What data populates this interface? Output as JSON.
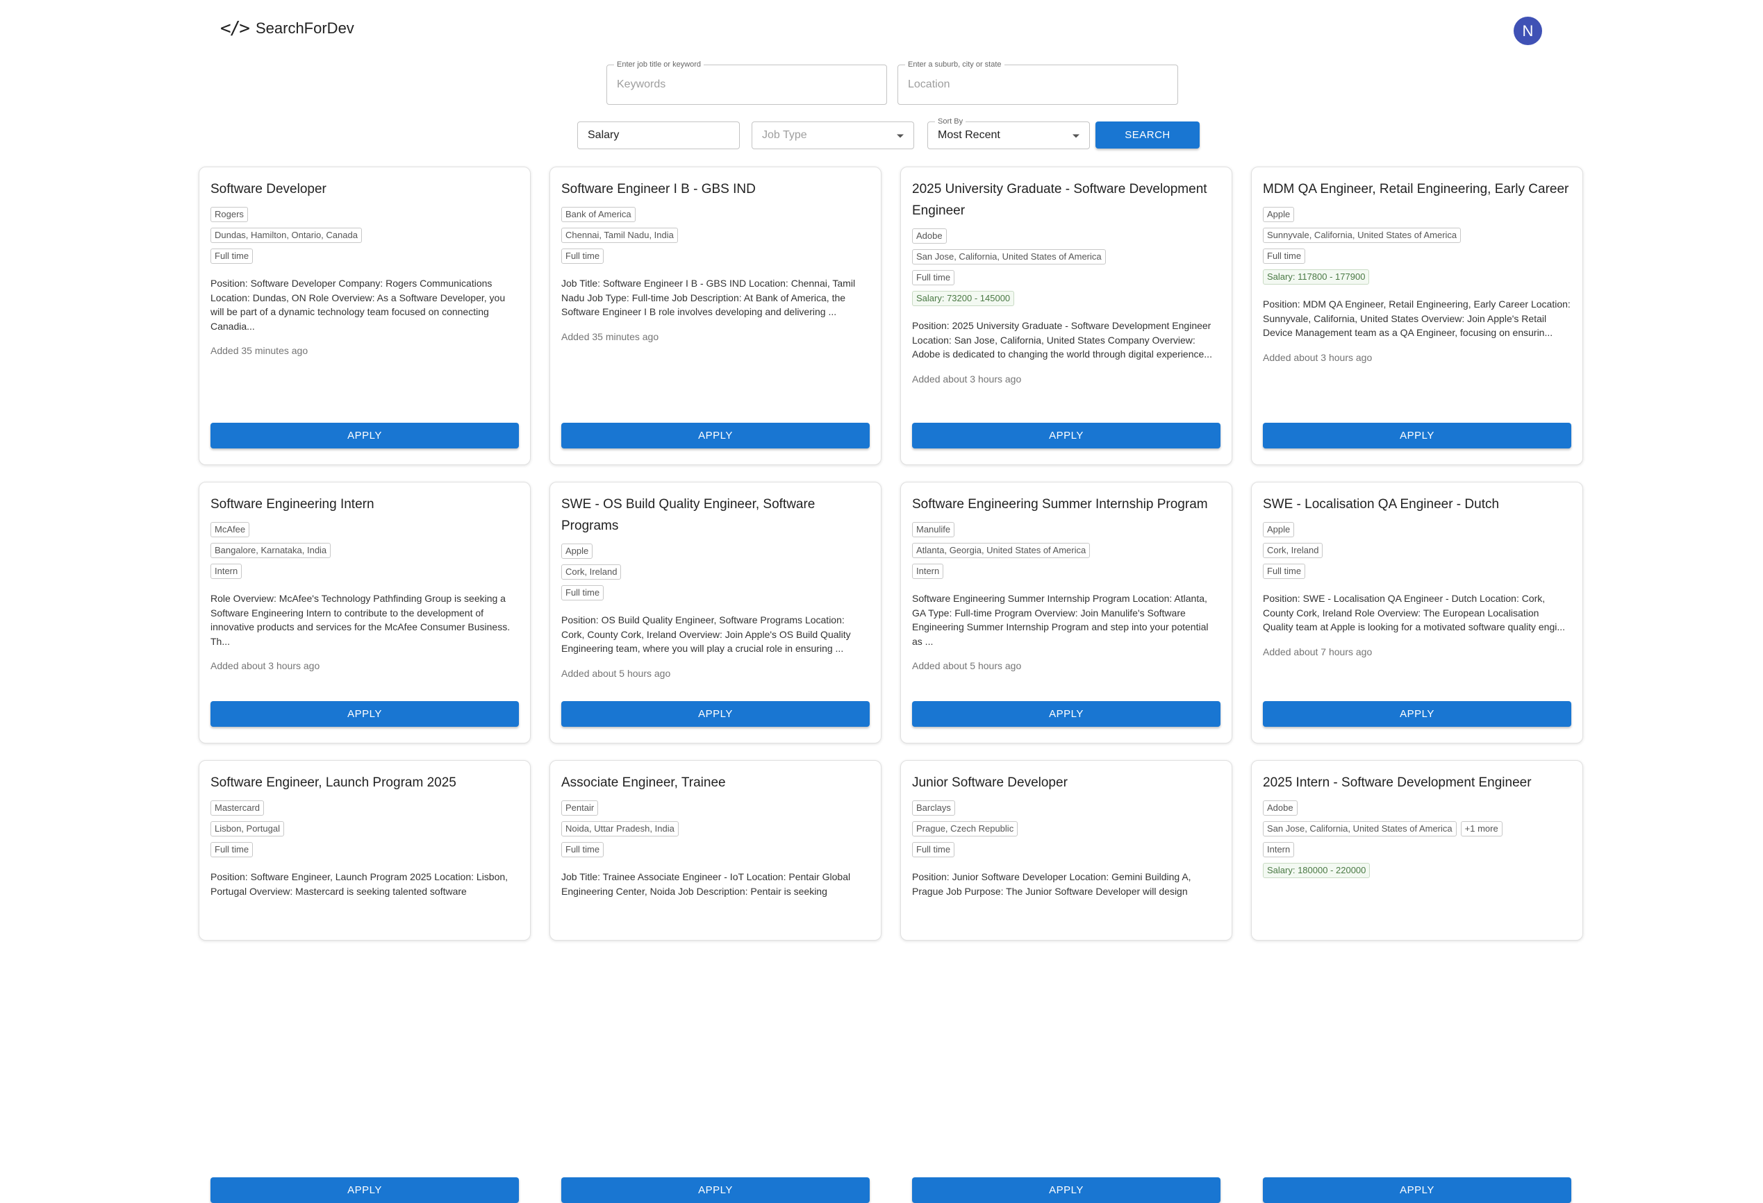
{
  "app": {
    "logo_icon": "</>",
    "logo_text": "SearchForDev",
    "avatar_initial": "N"
  },
  "search": {
    "keywords_legend": "Enter job title or keyword",
    "keywords_placeholder": "Keywords",
    "location_legend": "Enter a suburb, city or state",
    "location_placeholder": "Location",
    "salary_value": "Salary",
    "job_type_placeholder": "Job Type",
    "sort_legend": "Sort By",
    "sort_value": "Most Recent",
    "search_label": "SEARCH"
  },
  "apply_label": "APPLY",
  "jobs": [
    {
      "title": "Software Developer",
      "company": "Rogers",
      "location": "Dundas, Hamilton, Ontario, Canada",
      "type": "Full time",
      "salary": "",
      "more": "",
      "description": "Position: Software Developer Company: Rogers Communications Location: Dundas, ON Role Overview: As a Software Developer, you will be part of a dynamic technology team focused on connecting Canadia...",
      "added": "Added 35 minutes ago"
    },
    {
      "title": "Software Engineer I B - GBS IND",
      "company": "Bank of America",
      "location": "Chennai, Tamil Nadu, India",
      "type": "Full time",
      "salary": "",
      "more": "",
      "description": "Job Title: Software Engineer I B - GBS IND Location: Chennai, Tamil Nadu Job Type: Full-time Job Description: At Bank of America, the Software Engineer I B role involves developing and delivering ...",
      "added": "Added 35 minutes ago"
    },
    {
      "title": "2025 University Graduate - Software Development Engineer",
      "company": "Adobe",
      "location": "San Jose, California, United States of America",
      "type": "Full time",
      "salary": "Salary: 73200 - 145000",
      "more": "",
      "description": "Position: 2025 University Graduate - Software Development Engineer Location: San Jose, California, United States Company Overview: Adobe is dedicated to changing the world through digital experience...",
      "added": "Added about 3 hours ago"
    },
    {
      "title": "MDM QA Engineer, Retail Engineering, Early Career",
      "company": "Apple",
      "location": "Sunnyvale, California, United States of America",
      "type": "Full time",
      "salary": "Salary: 117800 - 177900",
      "more": "",
      "description": "Position: MDM QA Engineer, Retail Engineering, Early Career Location: Sunnyvale, California, United States Overview: Join Apple's Retail Device Management team as a QA Engineer, focusing on ensurin...",
      "added": "Added about 3 hours ago"
    },
    {
      "title": "Software Engineering Intern",
      "company": "McAfee",
      "location": "Bangalore, Karnataka, India",
      "type": "Intern",
      "salary": "",
      "more": "",
      "description": "Role Overview: McAfee's Technology Pathfinding Group is seeking a Software Engineering Intern to contribute to the development of innovative products and services for the McAfee Consumer Business. Th...",
      "added": "Added about 3 hours ago"
    },
    {
      "title": "SWE - OS Build Quality Engineer, Software Programs",
      "company": "Apple",
      "location": "Cork, Ireland",
      "type": "Full time",
      "salary": "",
      "more": "",
      "description": "Position: OS Build Quality Engineer, Software Programs Location: Cork, County Cork, Ireland Overview: Join Apple's OS Build Quality Engineering team, where you will play a crucial role in ensuring ...",
      "added": "Added about 5 hours ago"
    },
    {
      "title": "Software Engineering Summer Internship Program",
      "company": "Manulife",
      "location": "Atlanta, Georgia, United States of America",
      "type": "Intern",
      "salary": "",
      "more": "",
      "description": "Software Engineering Summer Internship Program Location: Atlanta, GA Type: Full-time Program Overview: Join Manulife's Software Engineering Summer Internship Program and step into your potential as ...",
      "added": "Added about 5 hours ago"
    },
    {
      "title": "SWE - Localisation QA Engineer - Dutch",
      "company": "Apple",
      "location": "Cork, Ireland",
      "type": "Full time",
      "salary": "",
      "more": "",
      "description": "Position: SWE - Localisation QA Engineer - Dutch Location: Cork, County Cork, Ireland Role Overview: The European Localisation Quality team at Apple is looking for a motivated software quality engi...",
      "added": "Added about 7 hours ago"
    },
    {
      "title": "Software Engineer, Launch Program 2025",
      "company": "Mastercard",
      "location": "Lisbon, Portugal",
      "type": "Full time",
      "salary": "",
      "more": "",
      "description": "Position: Software Engineer, Launch Program 2025 Location: Lisbon, Portugal Overview: Mastercard is seeking talented software",
      "added": ""
    },
    {
      "title": "Associate Engineer, Trainee",
      "company": "Pentair",
      "location": "Noida, Uttar Pradesh, India",
      "type": "Full time",
      "salary": "",
      "more": "",
      "description": "Job Title: Trainee Associate Engineer - IoT Location: Pentair Global Engineering Center, Noida Job Description: Pentair is seeking",
      "added": ""
    },
    {
      "title": "Junior Software Developer",
      "company": "Barclays",
      "location": "Prague, Czech Republic",
      "type": "Full time",
      "salary": "",
      "more": "",
      "description": "Position: Junior Software Developer Location: Gemini Building A, Prague Job Purpose: The Junior Software Developer will design",
      "added": ""
    },
    {
      "title": "2025 Intern - Software Development Engineer",
      "company": "Adobe",
      "location": "San Jose, California, United States of America",
      "type": "Intern",
      "salary": "Salary: 180000 - 220000",
      "more": "+1 more",
      "description": "",
      "added": ""
    }
  ]
}
